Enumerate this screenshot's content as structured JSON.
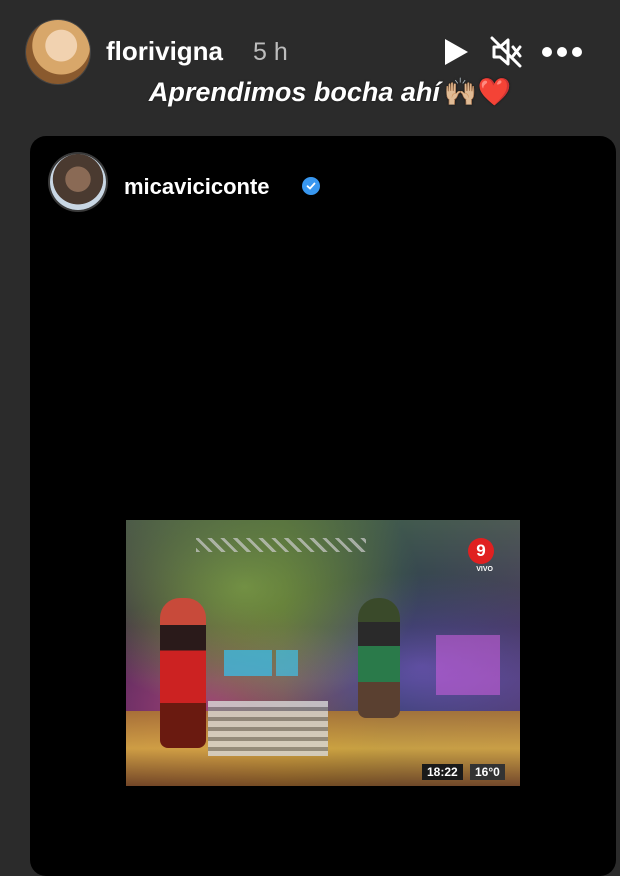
{
  "story": {
    "username": "florivigna",
    "timestamp": "5 h",
    "caption": "Aprendimos bocha ahí",
    "caption_emoji": "🙌🏼❤️",
    "controls": {
      "play_icon": "play-icon",
      "mute_icon": "muted-speaker-icon",
      "more_icon": "more-options-icon"
    }
  },
  "shared_post": {
    "username": "micaviciconte",
    "verified": true,
    "verified_color": "#3897f0"
  },
  "video_overlay": {
    "channel_number": "9",
    "live_label": "VIVO",
    "clock": "18:22",
    "temperature": "16°0"
  },
  "colors": {
    "background": "#2b2b2b",
    "card": "#000000",
    "channel_red": "#e02020"
  }
}
